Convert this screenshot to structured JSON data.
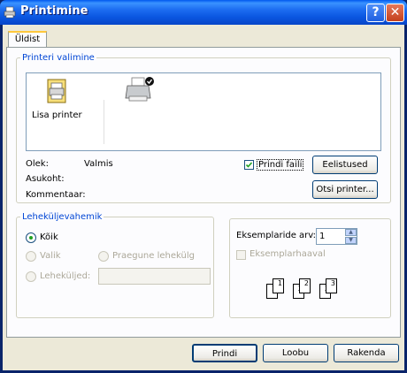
{
  "window": {
    "title": "Printimine",
    "title_icon": "print-icon",
    "help_label": "?",
    "close_label": "✕"
  },
  "tabs": [
    {
      "label": "Üldist"
    }
  ],
  "select_printer": {
    "legend": "Printeri valimine",
    "printers": [
      {
        "label": "Lisa printer",
        "icon": "add-printer-icon"
      },
      {
        "label": "",
        "icon": "default-printer-icon"
      }
    ],
    "status_label": "Olek:",
    "status_value": "Valmis",
    "location_label": "Asukoht:",
    "location_value": "",
    "comment_label": "Kommentaar:",
    "comment_value": "",
    "print_to_file_label": "Prindi faili",
    "print_to_file_checked": true,
    "preferences_button": "Eelistused",
    "find_printer_button": "Otsi printer..."
  },
  "page_range": {
    "legend": "Leheküljevahemik",
    "all_label": "Kõik",
    "all_selected": true,
    "selection_label": "Valik",
    "current_page_label": "Praegune lehekülg",
    "pages_label": "Leheküljed:",
    "pages_value": ""
  },
  "copies": {
    "count_label": "Eksemplaride arv:",
    "count_value": "1",
    "collate_label": "Eksemplarhaaval",
    "collate_checked": false,
    "collate_pages": [
      "1",
      "1",
      "2",
      "2",
      "3",
      "3"
    ]
  },
  "footer": {
    "print_button": "Prindi",
    "cancel_button": "Loobu",
    "apply_button": "Rakenda"
  }
}
